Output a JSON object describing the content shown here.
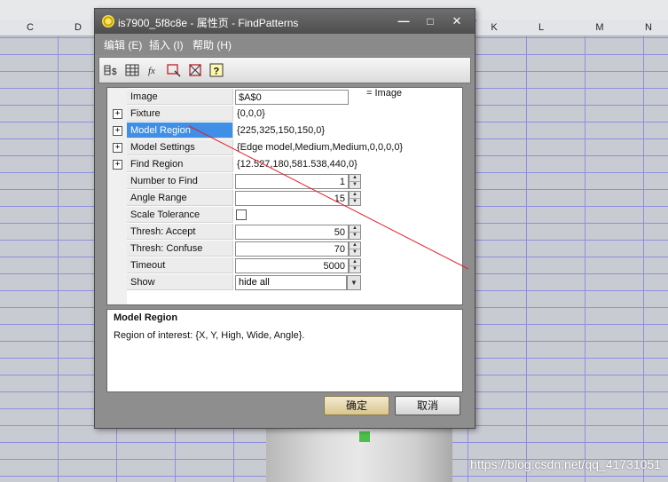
{
  "spreadsheet": {
    "columns": [
      "C",
      "D",
      "K",
      "L",
      "M",
      "N"
    ]
  },
  "watermark": "https://blog.csdn.net/qq_41731051",
  "dialog": {
    "title": "is7900_5f8c8e - 属性页 - FindPatterns",
    "window_buttons": {
      "minimize": "—",
      "maximize": "□",
      "close": "✕"
    },
    "menu": [
      {
        "label": "编辑 (E)"
      },
      {
        "label": "插入 (I)"
      },
      {
        "label": "帮助 (H)"
      }
    ],
    "toolbar": [
      {
        "icon": "sort-icon"
      },
      {
        "icon": "table-icon"
      },
      {
        "icon": "function-icon"
      },
      {
        "icon": "region-select-icon"
      },
      {
        "icon": "region-fit-icon"
      },
      {
        "icon": "help-icon"
      }
    ],
    "properties": [
      {
        "name": "Image",
        "value": "$A$0",
        "suffix": "= Image",
        "type": "input"
      },
      {
        "name": "Fixture",
        "value": "{0,0,0}",
        "type": "text",
        "expandable": true
      },
      {
        "name": "Model Region",
        "value": "{225,325,150,150,0}",
        "type": "text",
        "expandable": true,
        "selected": true
      },
      {
        "name": "Model Settings",
        "value": "{Edge model,Medium,Medium,0,0,0,0}",
        "type": "text",
        "expandable": true
      },
      {
        "name": "Find Region",
        "value": "{12.527,180,581.538,440,0}",
        "type": "text",
        "expandable": true
      },
      {
        "name": "Number to Find",
        "value": "1",
        "type": "spin"
      },
      {
        "name": "Angle Range",
        "value": "15",
        "type": "spin"
      },
      {
        "name": "Scale Tolerance",
        "value": "",
        "type": "checkbox",
        "checked": false
      },
      {
        "name": "Thresh: Accept",
        "value": "50",
        "type": "spin"
      },
      {
        "name": "Thresh: Confuse",
        "value": "70",
        "type": "spin"
      },
      {
        "name": "Timeout",
        "value": "5000",
        "type": "spin"
      },
      {
        "name": "Show",
        "value": "hide all",
        "type": "select"
      }
    ],
    "expander_symbol": "+",
    "description": {
      "title": "Model Region",
      "text": "Region of interest: {X, Y, High, Wide, Angle}."
    },
    "buttons": {
      "ok": "确定",
      "cancel": "取消"
    },
    "colors": {
      "selection": "#3f8fe6",
      "annotation_line": "#e0202a"
    }
  }
}
